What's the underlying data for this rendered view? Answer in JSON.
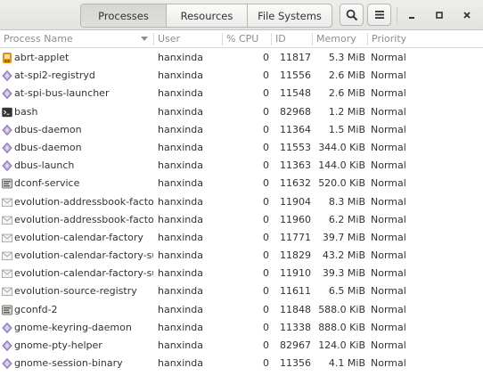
{
  "header": {
    "tabs": [
      {
        "label": "Processes",
        "active": true
      },
      {
        "label": "Resources",
        "active": false
      },
      {
        "label": "File Systems",
        "active": false
      }
    ],
    "search_icon": "search-icon",
    "menu_icon": "hamburger-menu-icon",
    "window_controls": [
      "minimize-icon",
      "maximize-icon",
      "close-icon"
    ]
  },
  "columns": {
    "name": "Process Name",
    "user": "User",
    "cpu": "% CPU",
    "id": "ID",
    "memory": "Memory",
    "priority": "Priority"
  },
  "processes": [
    {
      "name": "abrt-applet",
      "icon": "abrt",
      "user": "hanxinda",
      "cpu": "0",
      "id": "11817",
      "memory": "5.3 MiB",
      "priority": "Normal"
    },
    {
      "name": "at-spi2-registryd",
      "icon": "diamond",
      "user": "hanxinda",
      "cpu": "0",
      "id": "11556",
      "memory": "2.6 MiB",
      "priority": "Normal"
    },
    {
      "name": "at-spi-bus-launcher",
      "icon": "diamond",
      "user": "hanxinda",
      "cpu": "0",
      "id": "11548",
      "memory": "2.6 MiB",
      "priority": "Normal"
    },
    {
      "name": "bash",
      "icon": "terminal",
      "user": "hanxinda",
      "cpu": "0",
      "id": "82968",
      "memory": "1.2 MiB",
      "priority": "Normal"
    },
    {
      "name": "dbus-daemon",
      "icon": "diamond",
      "user": "hanxinda",
      "cpu": "0",
      "id": "11364",
      "memory": "1.5 MiB",
      "priority": "Normal"
    },
    {
      "name": "dbus-daemon",
      "icon": "diamond",
      "user": "hanxinda",
      "cpu": "0",
      "id": "11553",
      "memory": "344.0 KiB",
      "priority": "Normal"
    },
    {
      "name": "dbus-launch",
      "icon": "diamond",
      "user": "hanxinda",
      "cpu": "0",
      "id": "11363",
      "memory": "144.0 KiB",
      "priority": "Normal"
    },
    {
      "name": "dconf-service",
      "icon": "config",
      "user": "hanxinda",
      "cpu": "0",
      "id": "11632",
      "memory": "520.0 KiB",
      "priority": "Normal"
    },
    {
      "name": "evolution-addressbook-factory",
      "icon": "mail",
      "user": "hanxinda",
      "cpu": "0",
      "id": "11904",
      "memory": "8.3 MiB",
      "priority": "Normal"
    },
    {
      "name": "evolution-addressbook-factory-",
      "icon": "mail",
      "user": "hanxinda",
      "cpu": "0",
      "id": "11960",
      "memory": "6.2 MiB",
      "priority": "Normal"
    },
    {
      "name": "evolution-calendar-factory",
      "icon": "mail",
      "user": "hanxinda",
      "cpu": "0",
      "id": "11771",
      "memory": "39.7 MiB",
      "priority": "Normal"
    },
    {
      "name": "evolution-calendar-factory-subp",
      "icon": "mail",
      "user": "hanxinda",
      "cpu": "0",
      "id": "11829",
      "memory": "43.2 MiB",
      "priority": "Normal"
    },
    {
      "name": "evolution-calendar-factory-subp",
      "icon": "mail",
      "user": "hanxinda",
      "cpu": "0",
      "id": "11910",
      "memory": "39.3 MiB",
      "priority": "Normal"
    },
    {
      "name": "evolution-source-registry",
      "icon": "mail",
      "user": "hanxinda",
      "cpu": "0",
      "id": "11611",
      "memory": "6.5 MiB",
      "priority": "Normal"
    },
    {
      "name": "gconfd-2",
      "icon": "config",
      "user": "hanxinda",
      "cpu": "0",
      "id": "11848",
      "memory": "588.0 KiB",
      "priority": "Normal"
    },
    {
      "name": "gnome-keyring-daemon",
      "icon": "diamond",
      "user": "hanxinda",
      "cpu": "0",
      "id": "11338",
      "memory": "888.0 KiB",
      "priority": "Normal"
    },
    {
      "name": "gnome-pty-helper",
      "icon": "diamond",
      "user": "hanxinda",
      "cpu": "0",
      "id": "82967",
      "memory": "124.0 KiB",
      "priority": "Normal"
    },
    {
      "name": "gnome-session-binary",
      "icon": "diamond",
      "user": "hanxinda",
      "cpu": "0",
      "id": "11356",
      "memory": "4.1 MiB",
      "priority": "Normal"
    }
  ]
}
